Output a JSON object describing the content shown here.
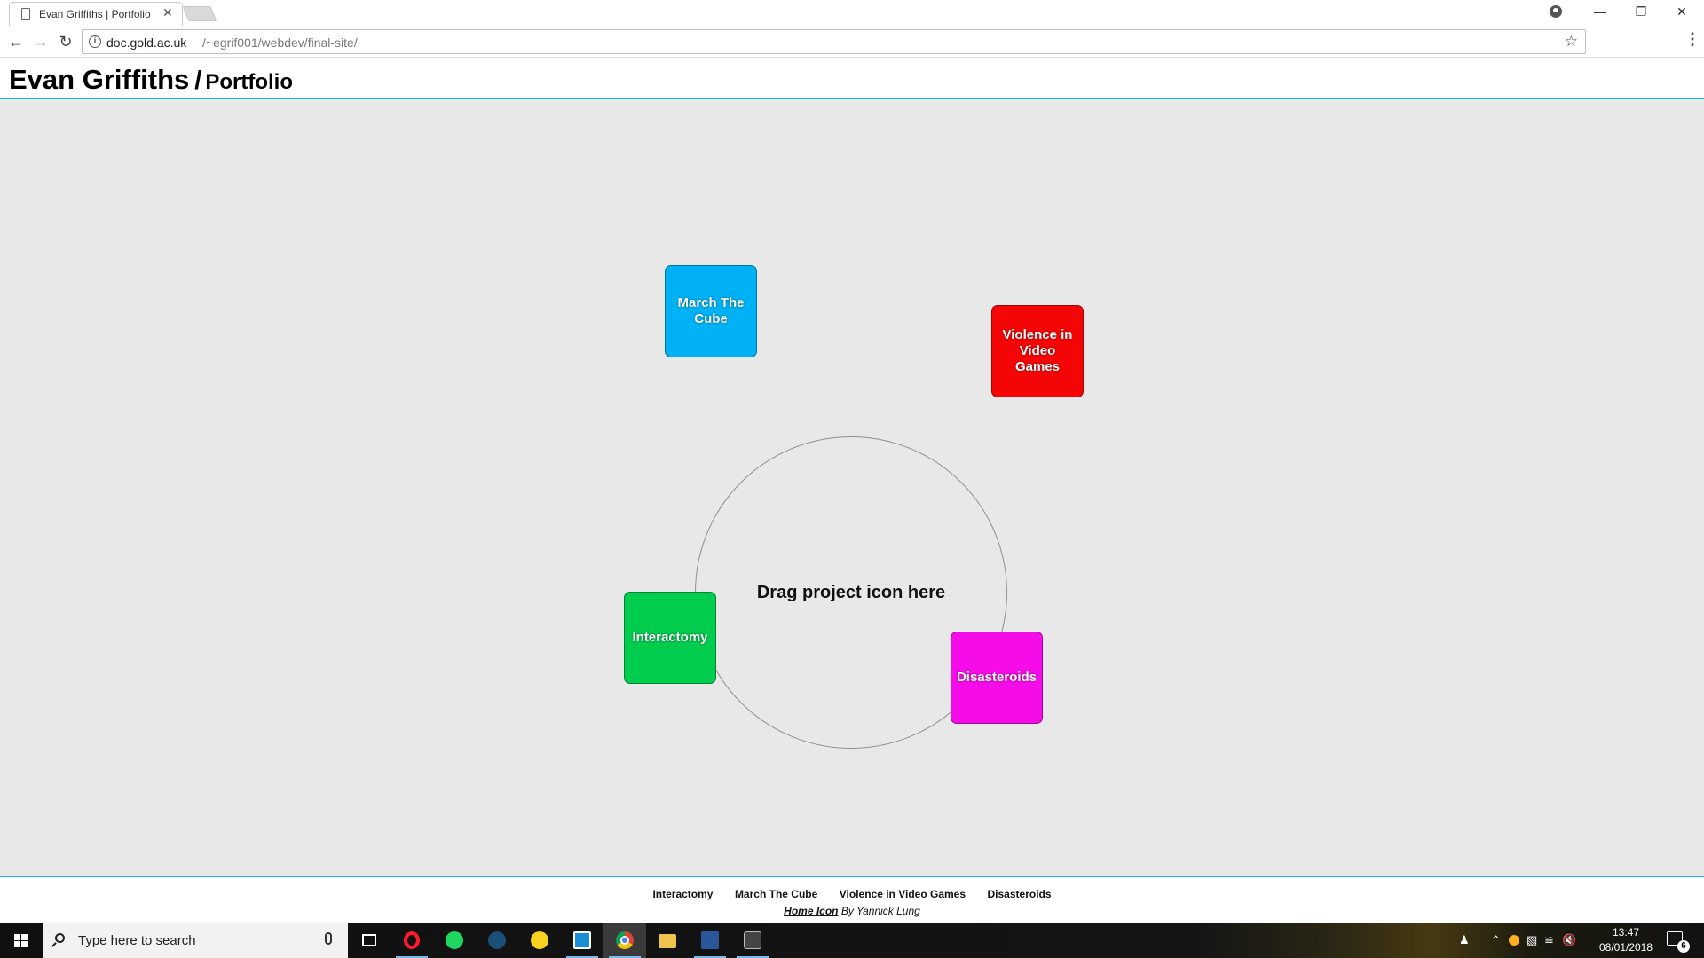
{
  "browser": {
    "tab_title": "Evan Griffiths | Portfolio",
    "url_host": "doc.gold.ac.uk",
    "url_path": "/~egrif001/webdev/final-site/"
  },
  "page": {
    "title": "Evan Griffiths",
    "separator": "/",
    "subtitle": "Portfolio",
    "drop_zone_label": "Drag project icon here",
    "projects": [
      {
        "label": "March The Cube",
        "color": "#00b2f5"
      },
      {
        "label": "Violence in Video Games",
        "color": "#f50606"
      },
      {
        "label": "Interactomy",
        "color": "#00cc4e"
      },
      {
        "label": "Disasteroids",
        "color": "#f50ce8"
      }
    ],
    "footer": {
      "links": [
        "Interactomy",
        "March The Cube",
        "Violence in Video Games",
        "Disasteroids"
      ],
      "credit_link": "Home Icon",
      "credit_text": "By Yannick Lung"
    }
  },
  "taskbar": {
    "search_placeholder": "Type here to search",
    "clock_time": "13:47",
    "clock_date": "08/01/2018",
    "notification_count": "6"
  }
}
